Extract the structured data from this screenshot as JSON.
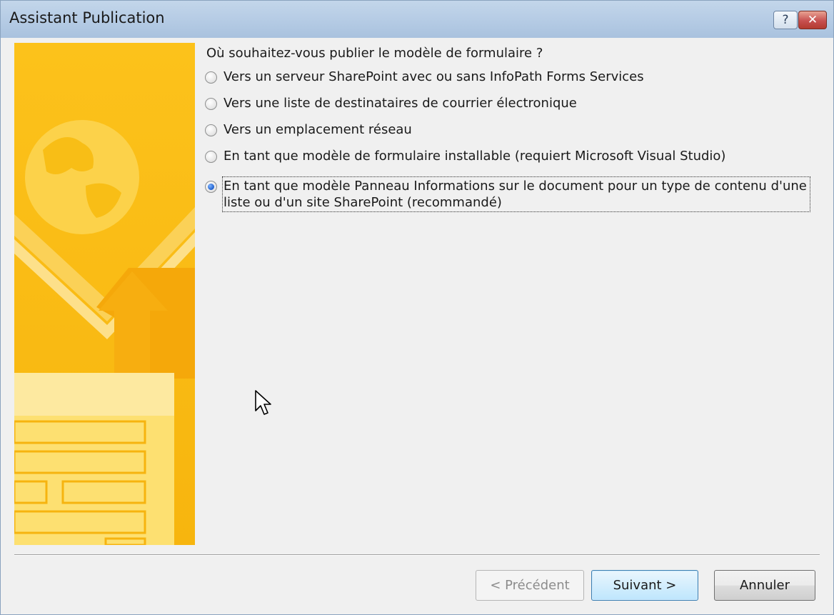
{
  "window": {
    "title": "Assistant Publication",
    "help_glyph": "?",
    "close_glyph": "✕"
  },
  "main": {
    "question": "Où souhaitez-vous publier le modèle de formulaire ?",
    "options": [
      {
        "label": "Vers un serveur SharePoint avec ou sans InfoPath Forms Services",
        "checked": false
      },
      {
        "label": "Vers une liste de destinataires de courrier électronique",
        "checked": false
      },
      {
        "label": "Vers un emplacement réseau",
        "checked": false
      },
      {
        "label": "En tant que modèle de formulaire installable (requiert Microsoft Visual Studio)",
        "checked": false
      },
      {
        "label": "En tant que modèle Panneau Informations sur le document pour un type de contenu d'une liste ou d'un site SharePoint (recommandé)",
        "checked": true
      }
    ]
  },
  "footer": {
    "prev_label": "< Précédent",
    "next_label": "Suivant >",
    "cancel_label": "Annuler"
  },
  "colors": {
    "sidebar_base": "#f9c015",
    "sidebar_light": "#fddf6a",
    "accent_blue": "#3c7fb1"
  }
}
